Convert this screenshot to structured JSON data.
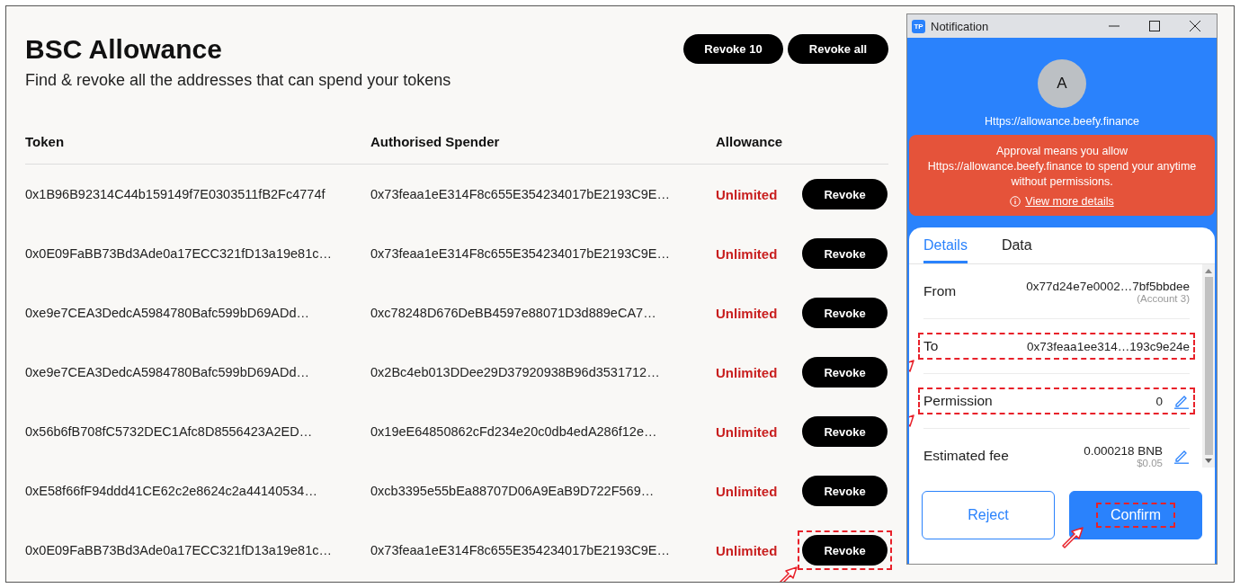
{
  "page": {
    "title": "BSC Allowance",
    "subtitle": "Find & revoke all the addresses that can spend your tokens",
    "actions": [
      {
        "label": "Revoke 10"
      },
      {
        "label": "Revoke all"
      }
    ]
  },
  "table": {
    "columns": [
      "Token",
      "Authorised Spender",
      "Allowance"
    ],
    "rows": [
      {
        "token": "0x1B96B92314C44b159149f7E0303511fB2Fc4774f",
        "spender": "0x73feaa1eE314F8c655E354234017bE2193C9E…",
        "allowance": "Unlimited",
        "action": "Revoke",
        "highlighted": false
      },
      {
        "token": "0x0E09FaBB73Bd3Ade0a17ECC321fD13a19e81c…",
        "spender": "0x73feaa1eE314F8c655E354234017bE2193C9E…",
        "allowance": "Unlimited",
        "action": "Revoke",
        "highlighted": false
      },
      {
        "token": "0xe9e7CEA3DedcA5984780Bafc599bD69ADd…",
        "spender": "0xc78248D676DeBB4597e88071D3d889eCA7…",
        "allowance": "Unlimited",
        "action": "Revoke",
        "highlighted": false
      },
      {
        "token": "0xe9e7CEA3DedcA5984780Bafc599bD69ADd…",
        "spender": "0x2Bc4eb013DDee29D37920938B96d3531712…",
        "allowance": "Unlimited",
        "action": "Revoke",
        "highlighted": false
      },
      {
        "token": "0x56b6fB708fC5732DEC1Afc8D8556423A2ED…",
        "spender": "0x19eE64850862cFd234e20c0db4edA286f12e…",
        "allowance": "Unlimited",
        "action": "Revoke",
        "highlighted": false
      },
      {
        "token": "0xE58f66fF94ddd41CE62c2e8624c2a44140534…",
        "spender": "0xcb3395e55bEa88707D06A9EaB9D722F569…",
        "allowance": "Unlimited",
        "action": "Revoke",
        "highlighted": false
      },
      {
        "token": "0x0E09FaBB73Bd3Ade0a17ECC321fD13a19e81c…",
        "spender": "0x73feaa1eE314F8c655E354234017bE2193C9E…",
        "allowance": "Unlimited",
        "action": "Revoke",
        "highlighted": true
      }
    ]
  },
  "popup": {
    "title": "Notification",
    "app_badge": "TP",
    "avatar": "A",
    "site": "Https://allowance.beefy.finance",
    "warning": {
      "text": "Approval means you allow Https://allowance.beefy.finance to spend your anytime without permissions.",
      "link": "View more details"
    },
    "tabs": [
      {
        "label": "Details",
        "selected": true
      },
      {
        "label": "Data",
        "selected": false
      }
    ],
    "details": [
      {
        "label": "From",
        "value": "0x77d24e7e0002…7bf5bbdee",
        "note": "(Account 3)",
        "editable": false,
        "highlighted": false
      },
      {
        "label": "To",
        "value": "0x73feaa1ee314…193c9e24e",
        "editable": false,
        "highlighted": true
      },
      {
        "label": "Permission",
        "value": "0",
        "editable": true,
        "highlighted": true
      },
      {
        "label": "Estimated fee",
        "value": "0.000218 BNB",
        "note": "$0.05",
        "editable": true,
        "highlighted": false
      }
    ],
    "buttons": [
      {
        "label": "Reject",
        "kind": "secondary",
        "highlighted": false
      },
      {
        "label": "Confirm",
        "kind": "primary",
        "highlighted": true
      }
    ]
  }
}
